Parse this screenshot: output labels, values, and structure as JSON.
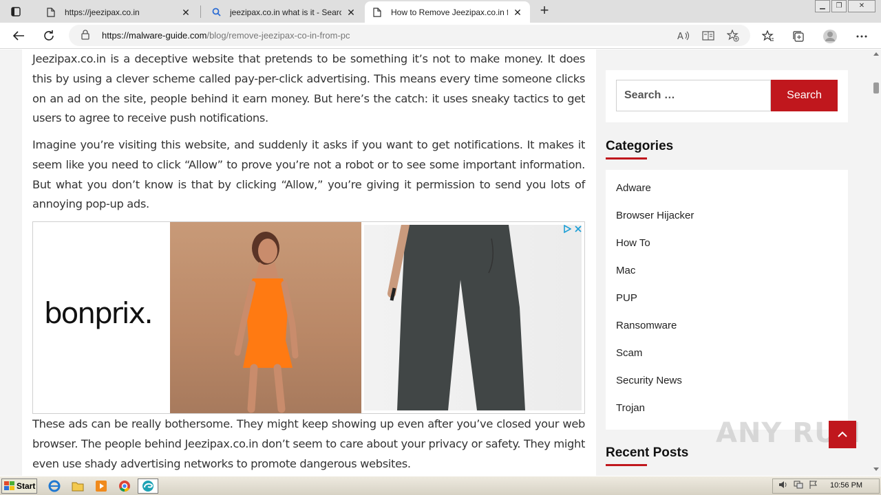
{
  "browser": {
    "tabs": [
      {
        "title": "https://jeezipax.co.in",
        "icon": "page-icon",
        "active": false
      },
      {
        "title": "jeezipax.co.in what is it - Search",
        "icon": "search-icon",
        "active": false
      },
      {
        "title": "How to Remove Jeezipax.co.in f",
        "icon": "page-icon",
        "active": true
      }
    ],
    "url_host": "https://malware-guide.com",
    "url_path": "/blog/remove-jeezipax-co-in-from-pc"
  },
  "article": {
    "para1": "Jeezipax.co.in is a deceptive website that pretends to be something it’s not to make money. It does this by using a clever scheme called pay-per-click advertising. This means every time someone clicks on an ad on the site, people behind it earn money. But here’s the catch: it uses sneaky tactics to get users to agree to receive push notifications.",
    "para2": "Imagine you’re visiting this website, and suddenly it asks if you want to get notifications. It makes it seem like you need to click “Allow” to prove you’re not a robot or to see some important information. But what you don’t know is that by clicking “Allow,” you’re giving it permission to send you lots of annoying pop-up ads.",
    "para3": "These ads can be really bothersome. They might keep showing up even after you’ve closed your web browser. The people behind Jeezipax.co.in don’t seem to care about your privacy or safety. They might even use shady advertising networks to promote dangerous websites."
  },
  "ad": {
    "brand": "bonprix."
  },
  "sidebar": {
    "search_placeholder": "Search …",
    "search_button": "Search",
    "categories_title": "Categories",
    "categories": [
      "Adware",
      "Browser Hijacker",
      "How To",
      "Mac",
      "PUP",
      "Ransomware",
      "Scam",
      "Security News",
      "Trojan"
    ],
    "recent_title": "Recent Posts"
  },
  "watermark": "ANY RUN",
  "taskbar": {
    "start_label": "Start",
    "clock": "10:56 PM"
  },
  "colors": {
    "accent": "#c0171d"
  }
}
